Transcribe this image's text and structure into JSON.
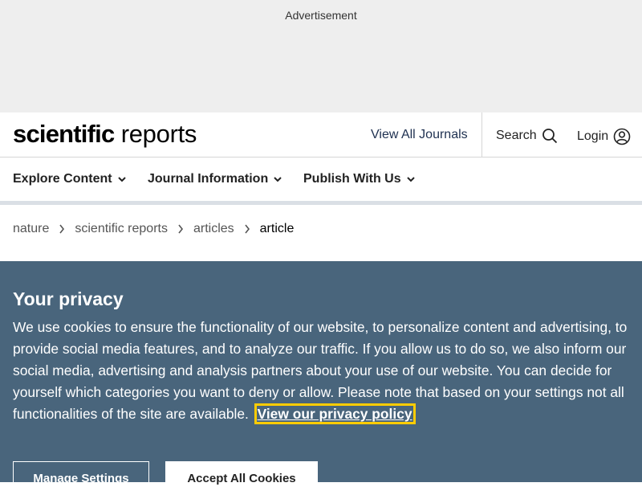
{
  "ad": {
    "label": "Advertisement"
  },
  "header": {
    "logo_bold": "scientific",
    "logo_regular": "reports",
    "view_all": "View All Journals",
    "search": "Search",
    "login": "Login"
  },
  "menu": {
    "items": [
      {
        "label": "Explore Content"
      },
      {
        "label": "Journal Information"
      },
      {
        "label": "Publish With Us"
      }
    ]
  },
  "breadcrumb": [
    "nature",
    "scientific reports",
    "articles",
    "article"
  ],
  "privacy": {
    "title": "Your privacy",
    "body": "We use cookies to ensure the functionality of our website, to personalize content and advertising, to provide social media features, and to analyze our traffic. If you allow us to do so, we also inform our social media, advertising and analysis partners about your use of our website. You can decide for yourself which categories you want to deny or allow. Please note that based on your settings not all functionalities of the site are available.",
    "link": "View our privacy policy",
    "manage": "Manage Settings",
    "accept": "Accept All Cookies"
  },
  "colors": {
    "banner_bg": "#49657c",
    "focus_outline": "#ffcc00",
    "ad_bg": "#eeeeee"
  },
  "icons": [
    "search-icon",
    "user-icon",
    "chevron-down-icon",
    "chevron-right-icon"
  ]
}
